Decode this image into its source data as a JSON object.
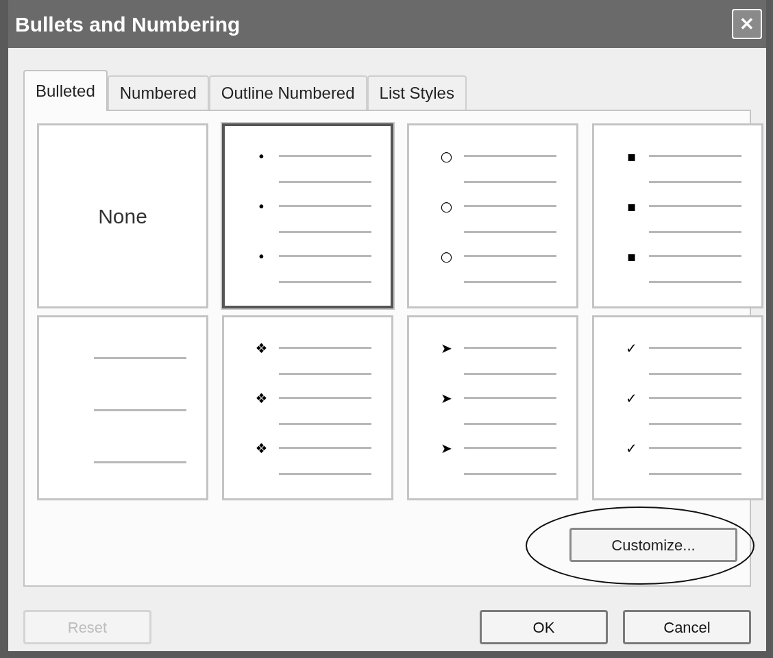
{
  "window": {
    "title": "Bullets and Numbering",
    "close": "✕"
  },
  "tabs": [
    {
      "label": "Bulleted",
      "selected": true
    },
    {
      "label": "Numbered",
      "selected": false
    },
    {
      "label": "Outline Numbered",
      "selected": false
    },
    {
      "label": "List Styles",
      "selected": false
    }
  ],
  "gallery": [
    {
      "kind": "none",
      "label": "None",
      "selected": false
    },
    {
      "kind": "bullet",
      "glyphs": [
        "•",
        "•",
        "•"
      ],
      "selected": true
    },
    {
      "kind": "bullet",
      "glyphs": [
        "○",
        "○",
        "○"
      ],
      "selected": false
    },
    {
      "kind": "bullet",
      "glyphs": [
        "▪",
        "▪",
        "▪"
      ],
      "selected": false
    },
    {
      "kind": "lines",
      "selected": false
    },
    {
      "kind": "bullet",
      "glyphs": [
        "❖",
        "❖",
        "❖"
      ],
      "selected": false
    },
    {
      "kind": "bullet",
      "glyphs": [
        "➤",
        "➤",
        "➤"
      ],
      "selected": false
    },
    {
      "kind": "bullet",
      "glyphs": [
        "✓",
        "✓",
        "✓"
      ],
      "selected": false
    }
  ],
  "customize_button": {
    "label": "Customize..."
  },
  "buttons": [
    {
      "label": "Reset",
      "disabled": true
    },
    {
      "label": "OK",
      "disabled": false
    },
    {
      "label": "Cancel",
      "disabled": false
    }
  ]
}
